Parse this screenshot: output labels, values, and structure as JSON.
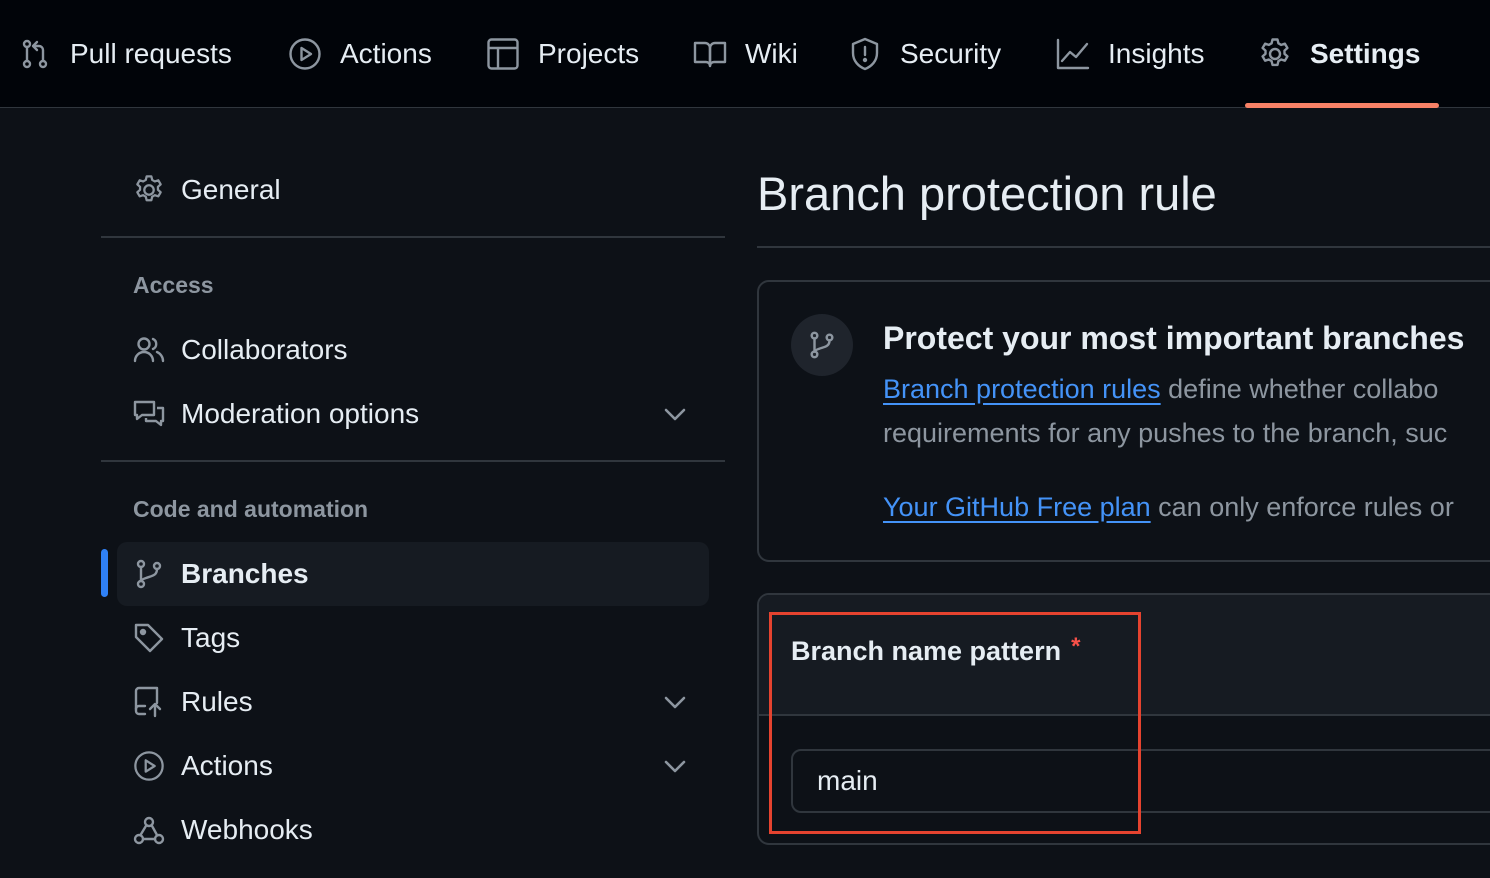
{
  "nav": {
    "tabs": [
      {
        "label": "Pull requests",
        "icon": "pull-request-icon"
      },
      {
        "label": "Actions",
        "icon": "play-circle-icon"
      },
      {
        "label": "Projects",
        "icon": "table-icon"
      },
      {
        "label": "Wiki",
        "icon": "book-icon"
      },
      {
        "label": "Security",
        "icon": "shield-icon"
      },
      {
        "label": "Insights",
        "icon": "graph-icon"
      },
      {
        "label": "Settings",
        "icon": "gear-icon",
        "active": true
      }
    ],
    "active_color": "#f78166"
  },
  "sidebar": {
    "general": "General",
    "access_label": "Access",
    "access_items": [
      {
        "label": "Collaborators",
        "icon": "people-icon"
      },
      {
        "label": "Moderation options",
        "icon": "comment-discussion-icon",
        "expandable": true
      }
    ],
    "code_label": "Code and automation",
    "code_items": [
      {
        "label": "Branches",
        "icon": "branch-icon",
        "selected": true
      },
      {
        "label": "Tags",
        "icon": "tag-icon"
      },
      {
        "label": "Rules",
        "icon": "repo-push-icon",
        "expandable": true
      },
      {
        "label": "Actions",
        "icon": "play-circle-icon",
        "expandable": true
      },
      {
        "label": "Webhooks",
        "icon": "webhook-icon"
      }
    ],
    "selected_color": "#2f81f7"
  },
  "main": {
    "title": "Branch protection rule",
    "intro": {
      "heading": "Protect your most important branches",
      "line1_link": "Branch protection rules",
      "line1_rest": " define whether collabo",
      "line2": "requirements for any pushes to the branch, suc",
      "line3_link": "Your GitHub Free plan",
      "line3_rest": " can only enforce rules or"
    },
    "pattern": {
      "label": "Branch name pattern",
      "required_mark": "*",
      "value": "main"
    },
    "link_color": "#4493f8",
    "highlight_color": "#e5432f"
  }
}
